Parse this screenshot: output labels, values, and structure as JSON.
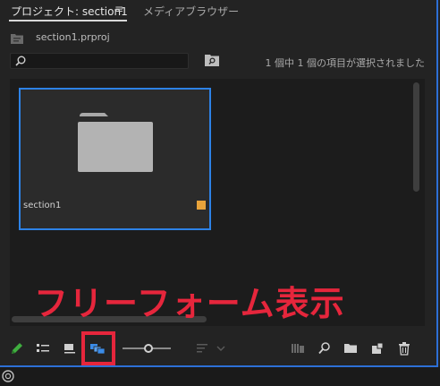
{
  "tabs": {
    "active_label": "プロジェクト: section1",
    "menu_glyph": "≡",
    "media_browser_label": "メディアブラウザー"
  },
  "project": {
    "file_name": "section1.prproj"
  },
  "search": {
    "placeholder": "",
    "status": "1 個中 1 個の項目が選択されました"
  },
  "bin": {
    "items": [
      {
        "name": "section1",
        "label_color": "#e8a33a",
        "selected": true
      }
    ]
  },
  "annotation": {
    "text": "フリーフォーム表示"
  },
  "toolbar": {
    "active_view": "freeform-view",
    "icons": [
      "pencil-icon",
      "list-view-icon",
      "icon-view-icon",
      "freeform-view-icon",
      "zoom-slider",
      "sort-icon",
      "automate-sequence-icon",
      "find-icon",
      "new-bin-icon",
      "new-item-icon",
      "trash-icon"
    ]
  },
  "colors": {
    "selection": "#2d82e6",
    "annotation": "#e6263c",
    "accent_edge": "#2d6fd6"
  }
}
